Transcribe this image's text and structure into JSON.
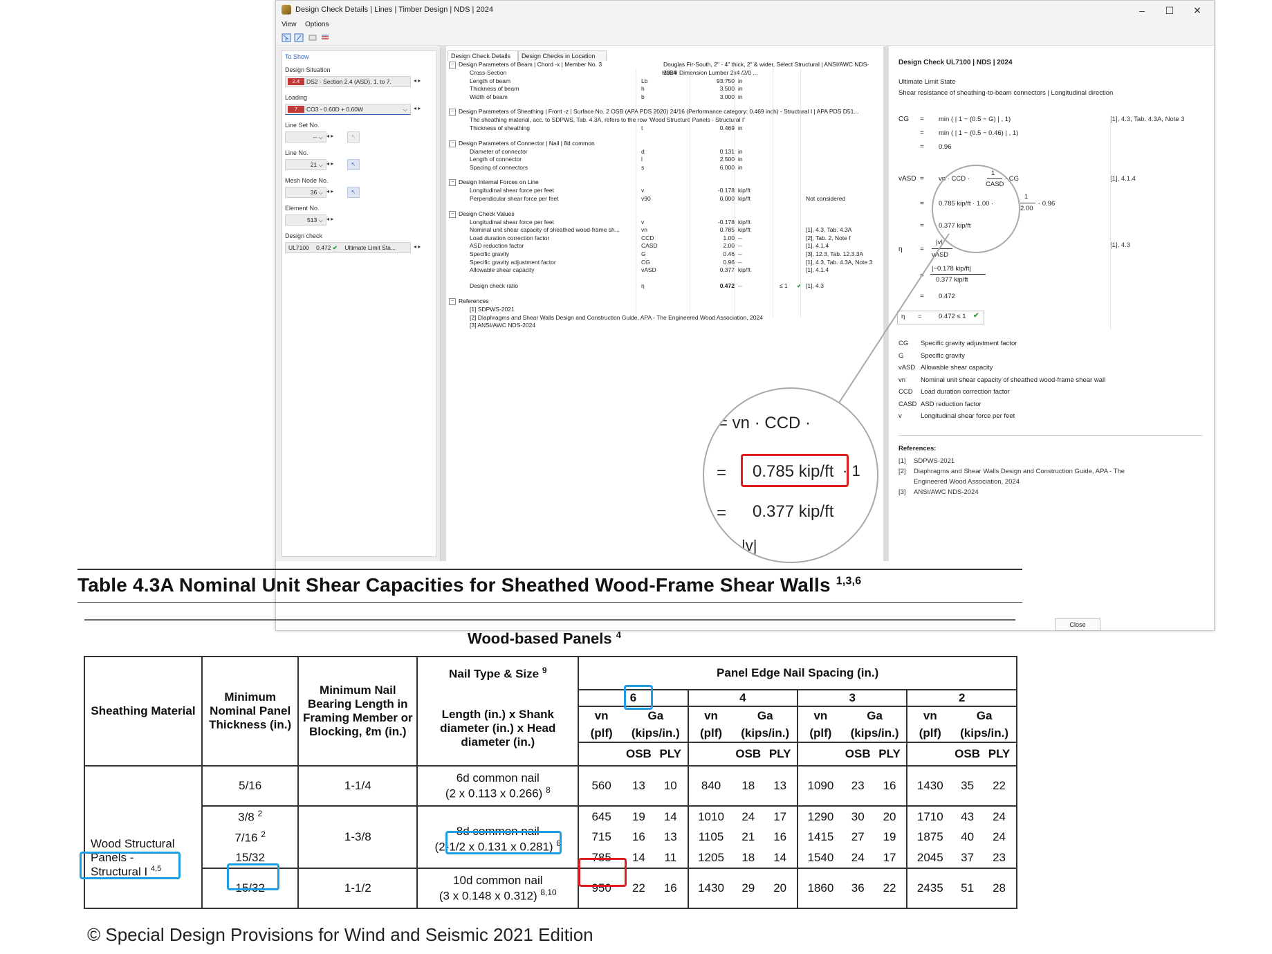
{
  "window": {
    "title": "Design Check Details | Lines | Timber Design | NDS | 2024",
    "menu": [
      "View",
      "Options"
    ],
    "controls": {
      "minimize": "–",
      "maximize": "☐",
      "close": "✕"
    },
    "close_button": "Close"
  },
  "left_panel": {
    "heading": "To Show",
    "design_situation": {
      "label": "Design Situation",
      "tag": "2.4",
      "value": "DS2 - Section 2.4 (ASD), 1. to 7."
    },
    "loading": {
      "label": "Loading",
      "tag": "7",
      "value": "CO3 - 0.60D + 0.60W"
    },
    "line_set_no": {
      "label": "Line Set No.",
      "value": "--"
    },
    "line_no": {
      "label": "Line No.",
      "value": "21"
    },
    "mesh_node_no": {
      "label": "Mesh Node No.",
      "value": "36"
    },
    "element_no": {
      "label": "Element No.",
      "value": "513"
    },
    "design_check": {
      "label": "Design check",
      "id": "UL7100",
      "ratio": "0.472",
      "type": "Ultimate Limit Sta..."
    }
  },
  "tabs": [
    "Design Check Details",
    "Design Checks in Location"
  ],
  "sections": [
    {
      "title": "Design Parameters of Beam | Chord -x | Member No. 3",
      "extra": "Douglas Fir-South, 2\" - 4\" thick, 2\" & wider, Select Structural | ANSI/AWC NDS-2024",
      "rows": [
        {
          "d": "Cross-Section",
          "s": "",
          "v": "HnBH Dimension Lumber 2x4 /2/0 ...",
          "u": "",
          "c": "",
          "r": ""
        },
        {
          "d": "Length of beam",
          "s": "Lb",
          "v": "93.750",
          "u": "in",
          "c": "",
          "r": ""
        },
        {
          "d": "Thickness of beam",
          "s": "h",
          "v": "3.500",
          "u": "in",
          "c": "",
          "r": ""
        },
        {
          "d": "Width of beam",
          "s": "b",
          "v": "3.000",
          "u": "in",
          "c": "",
          "r": ""
        }
      ]
    },
    {
      "title": "Design Parameters of Sheathing | Front -z | Surface No. 2 OSB (APA PDS 2020) 24/16 (Performance category: 0.469 inch) - Structural I | APA PDS D51...",
      "extra": "",
      "rows": [
        {
          "d": "The sheathing material, acc. to SDPWS, Tab. 4.3A, refers to the row 'Wood Structure Panels - Structural I'",
          "s": "",
          "v": "",
          "u": "",
          "c": "",
          "r": ""
        },
        {
          "d": "Thickness of sheathing",
          "s": "t",
          "v": "0.469",
          "u": "in",
          "c": "",
          "r": ""
        }
      ]
    },
    {
      "title": "Design Parameters of Connector | Nail | 8d common",
      "extra": "",
      "rows": [
        {
          "d": "Diameter of connector",
          "s": "d",
          "v": "0.131",
          "u": "in",
          "c": "",
          "r": ""
        },
        {
          "d": "Length of connector",
          "s": "l",
          "v": "2.500",
          "u": "in",
          "c": "",
          "r": ""
        },
        {
          "d": "Spacing of connectors",
          "s": "s",
          "v": "6.000",
          "u": "in",
          "c": "",
          "r": ""
        }
      ]
    },
    {
      "title": "Design Internal Forces on Line",
      "extra": "",
      "rows": [
        {
          "d": "Longitudinal shear force per feet",
          "s": "v",
          "v": "-0.178",
          "u": "kip/ft",
          "c": "",
          "r": ""
        },
        {
          "d": "Perpendicular shear force per feet",
          "s": "v90",
          "v": "0.000",
          "u": "kip/ft",
          "c": "",
          "r": "Not considered"
        }
      ]
    },
    {
      "title": "Design Check Values",
      "extra": "",
      "rows": [
        {
          "d": "Longitudinal shear force per feet",
          "s": "v",
          "v": "-0.178",
          "u": "kip/ft",
          "c": "",
          "r": ""
        },
        {
          "d": "Nominal unit shear capacity of sheathed wood-frame sh...",
          "s": "vn",
          "v": "0.785",
          "u": "kip/ft",
          "c": "",
          "r": "[1], 4.3, Tab. 4.3A"
        },
        {
          "d": "Load duration correction factor",
          "s": "CCD",
          "v": "1.00",
          "u": "--",
          "c": "",
          "r": "[2], Tab. 2, Note f"
        },
        {
          "d": "ASD reduction factor",
          "s": "CASD",
          "v": "2.00",
          "u": "--",
          "c": "",
          "r": "[1], 4.1.4"
        },
        {
          "d": "Specific gravity",
          "s": "G",
          "v": "0.46",
          "u": "--",
          "c": "",
          "r": "[3], 12.3, Tab. 12.3.3A"
        },
        {
          "d": "Specific gravity adjustment factor",
          "s": "CG",
          "v": "0.96",
          "u": "--",
          "c": "",
          "r": "[1], 4.3, Tab. 4.3A, Note 3"
        },
        {
          "d": "Allowable shear capacity",
          "s": "vASD",
          "v": "0.377",
          "u": "kip/ft",
          "c": "",
          "r": "[1], 4.1.4"
        },
        {
          "d": "",
          "s": "",
          "v": "",
          "u": "",
          "c": "",
          "r": ""
        },
        {
          "d": "Design check ratio",
          "s": "η",
          "v": "0.472",
          "u": "--",
          "c": "≤ 1",
          "r": "[1], 4.3"
        }
      ]
    },
    {
      "title": "References",
      "extra": "",
      "rows": [
        {
          "d": "[1]  SDPWS-2021",
          "s": "",
          "v": "",
          "u": "",
          "c": "",
          "r": ""
        },
        {
          "d": "[2]  Diaphragms and Shear Walls Design and Construction Guide, APA - The Engineered Wood Association, 2024",
          "s": "",
          "v": "",
          "u": "",
          "c": "",
          "r": ""
        },
        {
          "d": "[3]  ANSI/AWC NDS-2024",
          "s": "",
          "v": "",
          "u": "",
          "c": "",
          "r": ""
        }
      ]
    }
  ],
  "right_panel": {
    "title": "Design Check UL7100 | NDS | 2024",
    "state": "Ultimate Limit State",
    "desc": "Shear resistance of sheathing-to-beam connectors | Longitudinal direction",
    "cg_lhs": "CG",
    "eq": "=",
    "cg_eq1": "min ( | 1  −  (0.5  −  G) | ,  1)",
    "cg_eq2": "min ( | 1  −  (0.5  −  0.46) | ,  1)",
    "cg_res": "0.96",
    "cg_ref": "[1], 4.3, Tab. 4.3A, Note 3",
    "vasd_lhs": "vASD",
    "vasd_eq1_a": "vn · CCD ·",
    "vasd_eq1_num": "1",
    "vasd_eq1_den": "CASD",
    "vasd_eq1_b": "· CG",
    "vasd_eq2_a": "0.785 kip/ft · 1.00 ·",
    "vasd_eq2_num": "1",
    "vasd_eq2_den": "2.00",
    "vasd_eq2_b": "· 0.96",
    "vasd_res": "0.377 kip/ft",
    "vasd_ref": "[1], 4.1.4",
    "eta_lhs": "η",
    "eta_num": "|v|",
    "eta_den": "vASD",
    "eta_num2": "|−0.178 kip/ft|",
    "eta_den2": "0.377 kip/ft",
    "eta_res": "0.472",
    "eta_ref": "[1], 4.3",
    "eta_box": "0.472  ≤ 1",
    "legend": [
      {
        "sym": "CG",
        "text": "Specific gravity adjustment factor"
      },
      {
        "sym": "G",
        "text": "Specific gravity"
      },
      {
        "sym": "vASD",
        "text": "Allowable shear capacity"
      },
      {
        "sym": "vn",
        "text": "Nominal unit shear capacity of sheathed wood-frame shear wall"
      },
      {
        "sym": "CCD",
        "text": "Load duration correction factor"
      },
      {
        "sym": "CASD",
        "text": "ASD reduction factor"
      },
      {
        "sym": "v",
        "text": "Longitudinal shear force per feet"
      }
    ],
    "refs_title": "References:",
    "refs": [
      {
        "n": "[1]",
        "t": "SDPWS-2021"
      },
      {
        "n": "[2]",
        "t": "Diaphragms and Shear Walls Design and Construction Guide, APA - The"
      },
      {
        "n": "",
        "t": "Engineered Wood Association, 2024"
      },
      {
        "n": "[3]",
        "t": "ANSI/AWC NDS-2024"
      }
    ]
  },
  "magnifier": {
    "line1": "=    vn  ·  CCD  ·",
    "line2_eq": "=",
    "line2_val": "0.785 kip/ft",
    "line2_tail": "· 1",
    "line3_eq": "=",
    "line3_val": "0.377 kip/ft",
    "line4": "|v|"
  },
  "shear_table": {
    "title": "Table 4.3A Nominal Unit Shear Capacities for Sheathed Wood-Frame Shear Walls",
    "title_sup": "1,3,6",
    "panel_group": "Wood-based Panels",
    "panel_group_sup": "4",
    "h_sheathing": "Sheathing Material",
    "h_thickness": "Minimum Nominal Panel Thickness (in.)",
    "h_bearing": "Minimum Nail Bearing Length in Framing Member or Blocking, ℓm (in.)",
    "h_nail_title": "Nail Type & Size",
    "h_nail_sup": "9",
    "h_nail_sub": "Length (in.) x Shank diameter (in.) x Head diameter (in.)",
    "h_spacing": "Panel Edge Nail Spacing (in.)",
    "spacings": [
      "6",
      "4",
      "3",
      "2"
    ],
    "vn": "vn",
    "ga": "Ga",
    "plf": "(plf)",
    "kips": "(kips/in.)",
    "osb": "OSB",
    "ply": "PLY",
    "material_1": "Wood Structural Panels -",
    "material_2": "Structural I",
    "material_sup": "4,5",
    "rows": [
      {
        "t": "5/16",
        "tsup": "",
        "b": "1-1/4",
        "nail": "6d common nail",
        "dims": "(2 x 0.113 x 0.266)",
        "dsup": "8",
        "vals": [
          "560",
          "13",
          "10",
          "840",
          "18",
          "13",
          "1090",
          "23",
          "16",
          "1430",
          "35",
          "22"
        ]
      },
      {
        "t": "3/8",
        "tsup": "2",
        "b": "1-3/8",
        "nail": "8d common nail",
        "dims": "(2-1/2 x 0.131 x 0.281)",
        "dsup": "8",
        "vals": [
          "645",
          "19",
          "14",
          "1010",
          "24",
          "17",
          "1290",
          "30",
          "20",
          "1710",
          "43",
          "24"
        ]
      },
      {
        "t": "7/16",
        "tsup": "2",
        "b": "",
        "nail": "",
        "dims": "",
        "dsup": "",
        "vals": [
          "715",
          "16",
          "13",
          "1105",
          "21",
          "16",
          "1415",
          "27",
          "19",
          "1875",
          "40",
          "24"
        ]
      },
      {
        "t": "15/32",
        "tsup": "",
        "b": "",
        "nail": "",
        "dims": "",
        "dsup": "",
        "vals": [
          "785",
          "14",
          "11",
          "1205",
          "18",
          "14",
          "1540",
          "24",
          "17",
          "2045",
          "37",
          "23"
        ]
      },
      {
        "t": "15/32",
        "tsup": "",
        "b": "1-1/2",
        "nail": "10d common nail",
        "dims": "(3 x 0.148 x 0.312)",
        "dsup": "8,10",
        "vals": [
          "950",
          "22",
          "16",
          "1430",
          "29",
          "20",
          "1860",
          "36",
          "22",
          "2435",
          "51",
          "28"
        ]
      }
    ]
  },
  "credit": "© Special Design Provisions for Wind and Seismic 2021 Edition",
  "colors": {
    "highlight_blue": "#1f9de3",
    "highlight_red": "#e01b1b",
    "tag_red": "#c03a3a",
    "link_blue": "#2a62b2"
  }
}
